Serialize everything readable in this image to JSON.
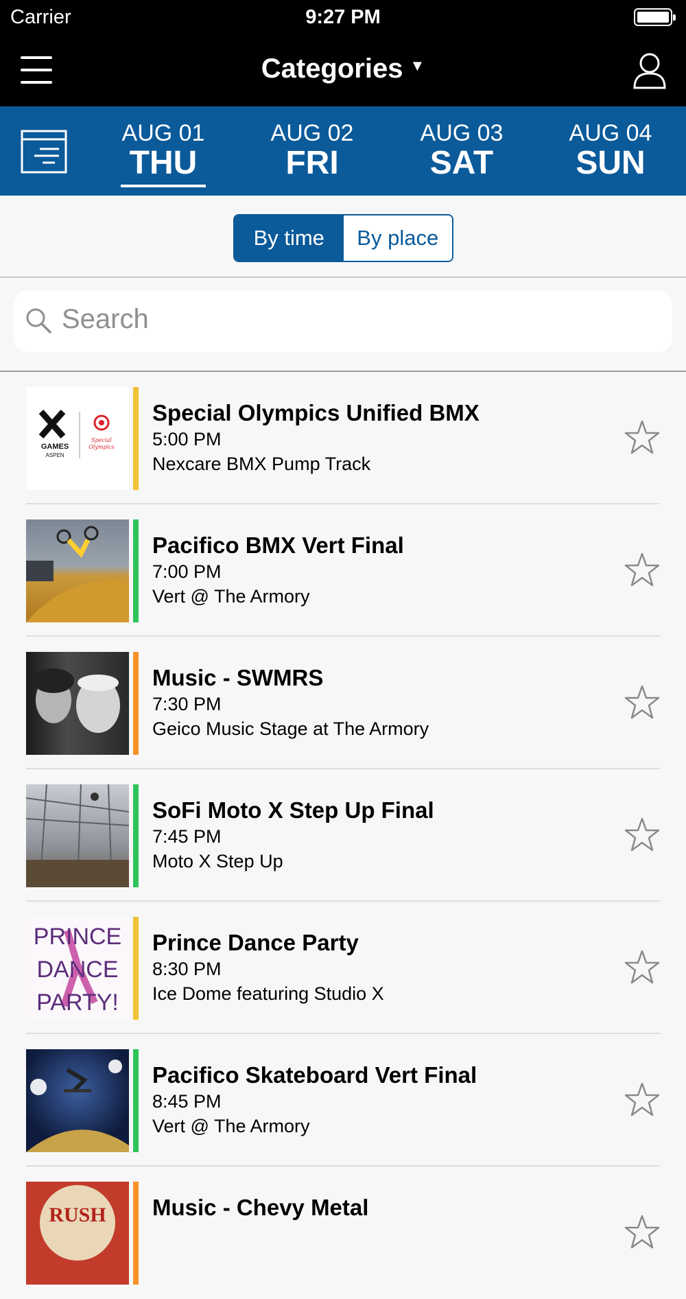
{
  "status": {
    "carrier": "Carrier",
    "time": "9:27 PM"
  },
  "nav": {
    "title": "Categories"
  },
  "dates": [
    {
      "month": "AUG 01",
      "dow": "THU",
      "active": true
    },
    {
      "month": "AUG 02",
      "dow": "FRI",
      "active": false
    },
    {
      "month": "AUG 03",
      "dow": "SAT",
      "active": false
    },
    {
      "month": "AUG 04",
      "dow": "SUN",
      "active": false
    }
  ],
  "segment": {
    "by_time": "By time",
    "by_place": "By place",
    "selected": "By time"
  },
  "search": {
    "placeholder": "Search"
  },
  "events": [
    {
      "title": "Special Olympics Unified BMX",
      "time": "5:00 PM",
      "place": "Nexcare BMX Pump Track",
      "color": "#f0c233",
      "thumb": "logo"
    },
    {
      "title": "Pacifico BMX Vert Final",
      "time": "7:00 PM",
      "place": "Vert @ The Armory",
      "color": "#2ec45a",
      "thumb": "bmx"
    },
    {
      "title": "Music - SWMRS",
      "time": "7:30 PM",
      "place": "Geico Music Stage at The Armory",
      "color": "#f7922a",
      "thumb": "bw"
    },
    {
      "title": "SoFi Moto X Step Up Final",
      "time": "7:45 PM",
      "place": "Moto X Step Up",
      "color": "#2ec45a",
      "thumb": "moto"
    },
    {
      "title": "Prince Dance Party",
      "time": "8:30 PM",
      "place": "Ice Dome featuring Studio X",
      "color": "#f0c233",
      "thumb": "prince"
    },
    {
      "title": "Pacifico Skateboard Vert Final",
      "time": "8:45 PM",
      "place": "Vert @ The Armory",
      "color": "#2ec45a",
      "thumb": "skate"
    },
    {
      "title": "Music - Chevy Metal",
      "time": "",
      "place": "",
      "color": "#f7922a",
      "thumb": "rush"
    }
  ],
  "thumb_text": {
    "logo_games": "GAMES",
    "logo_aspen": "ASPEN",
    "logo_so1": "Special",
    "logo_so2": "Olympics",
    "prince1": "PRINCE",
    "prince2": "DANCE",
    "prince3": "PARTY!",
    "rush": "RUSH"
  }
}
